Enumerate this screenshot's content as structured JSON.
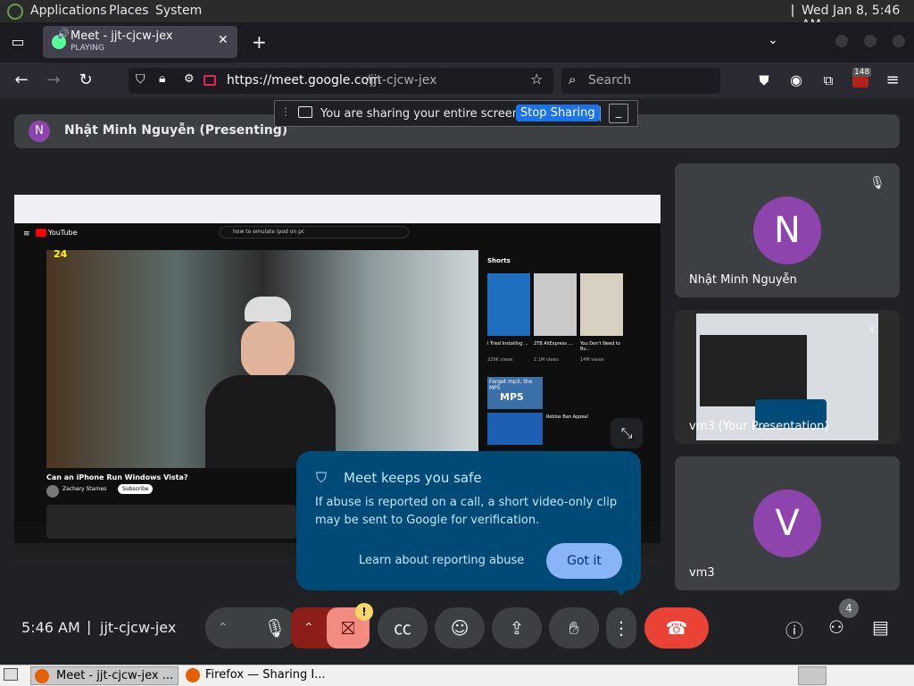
{
  "panel": {
    "applications": "Applications",
    "places": "Places",
    "system": "System",
    "clock": "Wed Jan  8,  5:46 AM"
  },
  "browser": {
    "tab_title": "Meet - jjt-cjcw-jex",
    "tab_subtitle": "PLAYING",
    "new_tab": "+",
    "url_host": "https://meet.google.com",
    "url_path": "/jjt-cjcw-jex",
    "search_placeholder": "Search",
    "badge_count": "148"
  },
  "share_banner": {
    "text": "You are sharing your entire screen.",
    "stop_button": "Stop Sharing"
  },
  "presenter": {
    "initial": "N",
    "name": "Nhật Minh Nguyễn (Presenting)"
  },
  "shared_screen": {
    "site": "YouTube",
    "query": "how to emulate ipod on pc",
    "video_title": "Can an iPhone Run Windows Vista?",
    "channel": "Zachary Starnes",
    "subscribe": "Subscribe",
    "timer": "24",
    "shorts_label": "Shorts",
    "shorts": [
      {
        "title": "I Tried Installing ...",
        "views": "229K views"
      },
      {
        "title": "2TB AliExpress ...",
        "views": "2.1M views"
      },
      {
        "title": "You Don't Need to Bu...",
        "views": "14M views"
      }
    ],
    "rec_title_1": "Forget mp3, the MP5",
    "rec_tag_1": "MP5",
    "rec_title_2": "Roblox Ban Appeal"
  },
  "participants": [
    {
      "initial": "N",
      "name": "Nhật Minh Nguyễn",
      "color": "#8e44ad"
    },
    {
      "name": "vm3 (Your Presentation)"
    },
    {
      "initial": "V",
      "name": "vm3",
      "color": "#8e44ad"
    }
  ],
  "popup": {
    "title": "Meet keeps you safe",
    "body": "If abuse is reported on a call, a short video-only clip may be sent to Google for verification.",
    "learn_link": "Learn about reporting abuse",
    "got_it": "Got it"
  },
  "bottom": {
    "time": "5:46 AM",
    "separator": "|",
    "meeting_code": "jjt-cjcw-jex",
    "people_count": "4",
    "warning": "!"
  },
  "taskbar": {
    "item1": "Meet - jjt-cjcw-jex ...",
    "item2": "Firefox — Sharing I..."
  },
  "colors": {
    "accent_blue": "#8ab4f8",
    "hangup_red": "#ea4335",
    "popup_bg": "#004a77",
    "cam_off_red": "#f28b82"
  }
}
